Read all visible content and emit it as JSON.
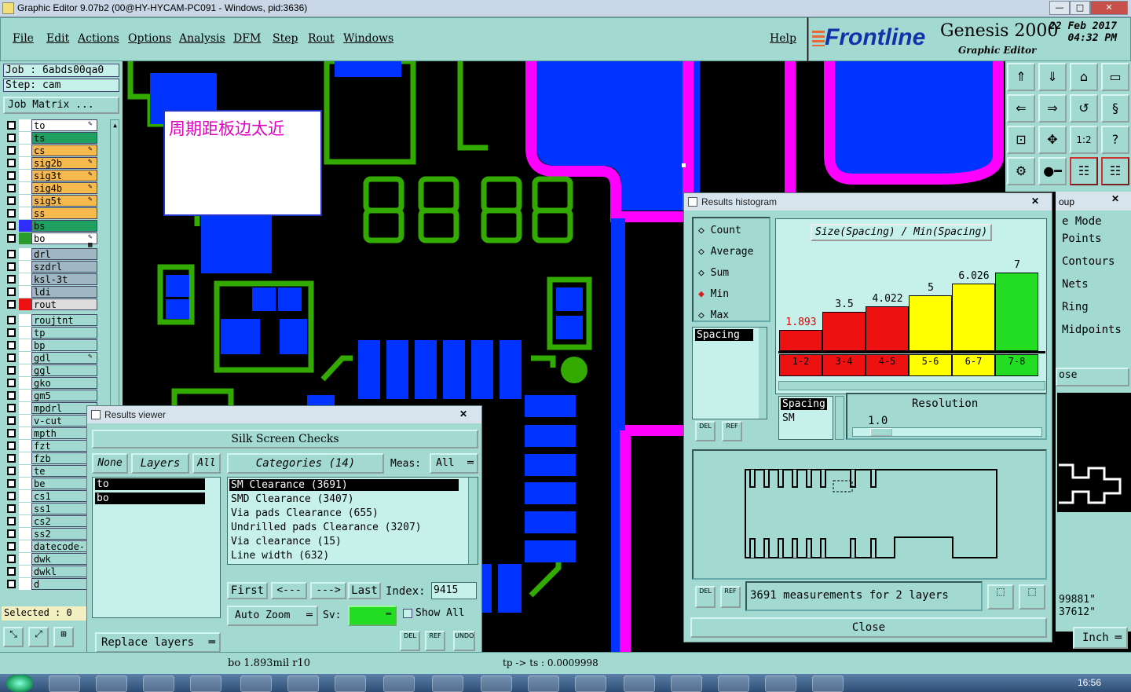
{
  "app": {
    "title": "Graphic Editor 9.07b2 (00@HY-HYCAM-PC091 - Windows, pid:3636)",
    "min": "—",
    "max": "□",
    "close": "✕"
  },
  "menu": [
    "File",
    "Edit",
    "Actions",
    "Options",
    "Analysis",
    "DFM",
    "Step",
    "Rout",
    "Windows"
  ],
  "help": "Help",
  "brand": {
    "logo": "Frontline",
    "product": "Genesis 2000",
    "subtitle": "Graphic Editor",
    "date": "22 Feb 2017",
    "time": "04:32 PM"
  },
  "job": {
    "job_label": "Job  :  6abds00qa0",
    "step_label": "Step: cam",
    "matrix_button": "Job Matrix ..."
  },
  "layers": [
    {
      "name": "to",
      "color": "#ffffff",
      "swatch": "#ffffff",
      "mark": "✎"
    },
    {
      "name": "ts",
      "color": "#1fa060",
      "swatch": "#ffffff",
      "mark": ""
    },
    {
      "name": "cs",
      "color": "#f5b94e",
      "swatch": "#ffffff",
      "mark": "✎"
    },
    {
      "name": "sig2b",
      "color": "#f5b94e",
      "swatch": "#ffffff",
      "mark": "✎"
    },
    {
      "name": "sig3t",
      "color": "#f5b94e",
      "swatch": "#ffffff",
      "mark": "✎"
    },
    {
      "name": "sig4b",
      "color": "#f5b94e",
      "swatch": "#ffffff",
      "mark": "✎"
    },
    {
      "name": "sig5t",
      "color": "#f5b94e",
      "swatch": "#ffffff",
      "mark": "✎"
    },
    {
      "name": "ss",
      "color": "#f5b94e",
      "swatch": "#ffffff",
      "mark": ""
    },
    {
      "name": "bs",
      "color": "#1fa060",
      "swatch": "#2d2dff",
      "mark": ""
    },
    {
      "name": "bo",
      "color": "#ffffff",
      "swatch": "#2a9a2a",
      "mark": "✎ ▦"
    },
    {
      "name": "drl",
      "color": "#9fb7c2",
      "swatch": "#ffffff",
      "mark": ""
    },
    {
      "name": "szdrl",
      "color": "#9fb7c2",
      "swatch": "#ffffff",
      "mark": ""
    },
    {
      "name": "ksl-3t",
      "color": "#9fb7c2",
      "swatch": "#ffffff",
      "mark": ""
    },
    {
      "name": "ldi",
      "color": "#9fb7c2",
      "swatch": "#ffffff",
      "mark": ""
    },
    {
      "name": "rout",
      "color": "#dcdcdc",
      "swatch": "#ee1111",
      "mark": ""
    },
    {
      "name": "roujtnt",
      "color": "#a2dad2",
      "swatch": "#ffffff",
      "mark": ""
    },
    {
      "name": "tp",
      "color": "#a2dad2",
      "swatch": "#ffffff",
      "mark": ""
    },
    {
      "name": "bp",
      "color": "#a2dad2",
      "swatch": "#ffffff",
      "mark": ""
    },
    {
      "name": "gdl",
      "color": "#a2dad2",
      "swatch": "#ffffff",
      "mark": "✎"
    },
    {
      "name": "ggl",
      "color": "#a2dad2",
      "swatch": "#ffffff",
      "mark": ""
    },
    {
      "name": "gko",
      "color": "#a2dad2",
      "swatch": "#ffffff",
      "mark": ""
    },
    {
      "name": "gm5",
      "color": "#a2dad2",
      "swatch": "#ffffff",
      "mark": ""
    },
    {
      "name": "mpdrl",
      "color": "#a2dad2",
      "swatch": "#ffffff",
      "mark": ""
    },
    {
      "name": "v-cut",
      "color": "#a2dad2",
      "swatch": "#ffffff",
      "mark": ""
    },
    {
      "name": "mpth",
      "color": "#a2dad2",
      "swatch": "#ffffff",
      "mark": ""
    },
    {
      "name": "fzt",
      "color": "#a2dad2",
      "swatch": "#ffffff",
      "mark": ""
    },
    {
      "name": "fzb",
      "color": "#a2dad2",
      "swatch": "#ffffff",
      "mark": ""
    },
    {
      "name": "te",
      "color": "#a2dad2",
      "swatch": "#ffffff",
      "mark": ""
    },
    {
      "name": "be",
      "color": "#a2dad2",
      "swatch": "#ffffff",
      "mark": ""
    },
    {
      "name": "cs1",
      "color": "#a2dad2",
      "swatch": "#ffffff",
      "mark": ""
    },
    {
      "name": "ss1",
      "color": "#a2dad2",
      "swatch": "#ffffff",
      "mark": ""
    },
    {
      "name": "cs2",
      "color": "#a2dad2",
      "swatch": "#ffffff",
      "mark": ""
    },
    {
      "name": "ss2",
      "color": "#a2dad2",
      "swatch": "#ffffff",
      "mark": ""
    },
    {
      "name": "datecode-",
      "color": "#a2dad2",
      "swatch": "#ffffff",
      "mark": ""
    },
    {
      "name": "dwk",
      "color": "#a2dad2",
      "swatch": "#ffffff",
      "mark": ""
    },
    {
      "name": "dwkl",
      "color": "#a2dad2",
      "swatch": "#ffffff",
      "mark": ""
    },
    {
      "name": "d",
      "color": "#a2dad2",
      "swatch": "#ffffff",
      "mark": ""
    }
  ],
  "selected": "Selected : 0",
  "canvas_note": "周期距板边太近",
  "right_menu": {
    "group_label": "oup",
    "items": [
      "e Mode",
      "Points",
      "Contours",
      "Nets",
      "Ring",
      "Midpoints"
    ],
    "close_label": "ose",
    "coord1": "99881\"",
    "coord2": "37612\"",
    "units": "Inch"
  },
  "results_viewer": {
    "title": "Results viewer",
    "header": "Silk Screen Checks",
    "none_btn": "None",
    "layers_btn": "Layers",
    "all_btn": "All",
    "layers": [
      "to",
      "bo"
    ],
    "categories_btn": "Categories (14)",
    "meas_label": "Meas:",
    "meas_value": "All",
    "categories": [
      "SM Clearance (3691)",
      "SMD Clearance (3407)",
      "Via pads Clearance (655)",
      "Undrilled pads Clearance (3207)",
      "Via clearance (15)",
      "Line width (632)"
    ],
    "first": "First",
    "prev": "<---",
    "next": "--->",
    "last": "Last",
    "index_label": "Index:",
    "index_value": "9415",
    "auto_zoom": "Auto Zoom",
    "sv_label": "Sv:",
    "show_all": "Show All",
    "replace_layers": "Replace layers",
    "del": "DEL",
    "ref": "REF",
    "undo": "UNDO"
  },
  "histogram": {
    "title": "Results histogram",
    "radio": [
      "Count",
      "Average",
      "Sum",
      "Min",
      "Max"
    ],
    "selected_radio": "Min",
    "list_item": "Spacing",
    "heading": "Size(Spacing) / Min(Spacing)",
    "spacing_label": "Spacing",
    "sm_label": "SM",
    "resolution_label": "Resolution",
    "resolution_value": "1.0",
    "measurements": "3691 measurements for 2 layers",
    "close": "Close",
    "del": "DEL",
    "ref": "REF"
  },
  "chart_data": {
    "type": "bar",
    "categories": [
      "1-2",
      "3-4",
      "4-5",
      "5-6",
      "6-7",
      "7-8"
    ],
    "values": [
      1.893,
      3.5,
      4.022,
      5,
      6.026,
      7
    ],
    "labels": [
      "1.893",
      "3.5",
      "4.022",
      "5",
      "6.026",
      "7"
    ],
    "colors": [
      "#ee1111",
      "#ee1111",
      "#ee1111",
      "#ffff00",
      "#ffff00",
      "#22dd22"
    ],
    "title": "Size(Spacing) / Min(Spacing)",
    "ylim": [
      0,
      7
    ]
  },
  "status": {
    "left": "bo 1.893mil   r10",
    "mid": "tp -> ts : 0.0009998"
  },
  "taskbar": {
    "clock": "16:56"
  }
}
